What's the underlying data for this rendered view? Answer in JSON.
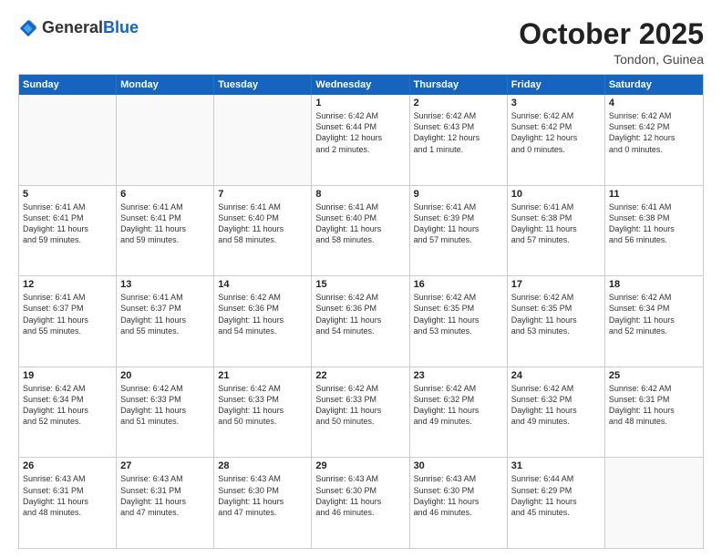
{
  "header": {
    "logo_general": "General",
    "logo_blue": "Blue",
    "month_title": "October 2025",
    "location": "Tondon, Guinea"
  },
  "days_of_week": [
    "Sunday",
    "Monday",
    "Tuesday",
    "Wednesday",
    "Thursday",
    "Friday",
    "Saturday"
  ],
  "weeks": [
    [
      {
        "day": "",
        "empty": true
      },
      {
        "day": "",
        "empty": true
      },
      {
        "day": "",
        "empty": true
      },
      {
        "day": "1",
        "lines": [
          "Sunrise: 6:42 AM",
          "Sunset: 6:44 PM",
          "Daylight: 12 hours",
          "and 2 minutes."
        ]
      },
      {
        "day": "2",
        "lines": [
          "Sunrise: 6:42 AM",
          "Sunset: 6:43 PM",
          "Daylight: 12 hours",
          "and 1 minute."
        ]
      },
      {
        "day": "3",
        "lines": [
          "Sunrise: 6:42 AM",
          "Sunset: 6:42 PM",
          "Daylight: 12 hours",
          "and 0 minutes."
        ]
      },
      {
        "day": "4",
        "lines": [
          "Sunrise: 6:42 AM",
          "Sunset: 6:42 PM",
          "Daylight: 12 hours",
          "and 0 minutes."
        ]
      }
    ],
    [
      {
        "day": "5",
        "lines": [
          "Sunrise: 6:41 AM",
          "Sunset: 6:41 PM",
          "Daylight: 11 hours",
          "and 59 minutes."
        ]
      },
      {
        "day": "6",
        "lines": [
          "Sunrise: 6:41 AM",
          "Sunset: 6:41 PM",
          "Daylight: 11 hours",
          "and 59 minutes."
        ]
      },
      {
        "day": "7",
        "lines": [
          "Sunrise: 6:41 AM",
          "Sunset: 6:40 PM",
          "Daylight: 11 hours",
          "and 58 minutes."
        ]
      },
      {
        "day": "8",
        "lines": [
          "Sunrise: 6:41 AM",
          "Sunset: 6:40 PM",
          "Daylight: 11 hours",
          "and 58 minutes."
        ]
      },
      {
        "day": "9",
        "lines": [
          "Sunrise: 6:41 AM",
          "Sunset: 6:39 PM",
          "Daylight: 11 hours",
          "and 57 minutes."
        ]
      },
      {
        "day": "10",
        "lines": [
          "Sunrise: 6:41 AM",
          "Sunset: 6:38 PM",
          "Daylight: 11 hours",
          "and 57 minutes."
        ]
      },
      {
        "day": "11",
        "lines": [
          "Sunrise: 6:41 AM",
          "Sunset: 6:38 PM",
          "Daylight: 11 hours",
          "and 56 minutes."
        ]
      }
    ],
    [
      {
        "day": "12",
        "lines": [
          "Sunrise: 6:41 AM",
          "Sunset: 6:37 PM",
          "Daylight: 11 hours",
          "and 55 minutes."
        ]
      },
      {
        "day": "13",
        "lines": [
          "Sunrise: 6:41 AM",
          "Sunset: 6:37 PM",
          "Daylight: 11 hours",
          "and 55 minutes."
        ]
      },
      {
        "day": "14",
        "lines": [
          "Sunrise: 6:42 AM",
          "Sunset: 6:36 PM",
          "Daylight: 11 hours",
          "and 54 minutes."
        ]
      },
      {
        "day": "15",
        "lines": [
          "Sunrise: 6:42 AM",
          "Sunset: 6:36 PM",
          "Daylight: 11 hours",
          "and 54 minutes."
        ]
      },
      {
        "day": "16",
        "lines": [
          "Sunrise: 6:42 AM",
          "Sunset: 6:35 PM",
          "Daylight: 11 hours",
          "and 53 minutes."
        ]
      },
      {
        "day": "17",
        "lines": [
          "Sunrise: 6:42 AM",
          "Sunset: 6:35 PM",
          "Daylight: 11 hours",
          "and 53 minutes."
        ]
      },
      {
        "day": "18",
        "lines": [
          "Sunrise: 6:42 AM",
          "Sunset: 6:34 PM",
          "Daylight: 11 hours",
          "and 52 minutes."
        ]
      }
    ],
    [
      {
        "day": "19",
        "lines": [
          "Sunrise: 6:42 AM",
          "Sunset: 6:34 PM",
          "Daylight: 11 hours",
          "and 52 minutes."
        ]
      },
      {
        "day": "20",
        "lines": [
          "Sunrise: 6:42 AM",
          "Sunset: 6:33 PM",
          "Daylight: 11 hours",
          "and 51 minutes."
        ]
      },
      {
        "day": "21",
        "lines": [
          "Sunrise: 6:42 AM",
          "Sunset: 6:33 PM",
          "Daylight: 11 hours",
          "and 50 minutes."
        ]
      },
      {
        "day": "22",
        "lines": [
          "Sunrise: 6:42 AM",
          "Sunset: 6:33 PM",
          "Daylight: 11 hours",
          "and 50 minutes."
        ]
      },
      {
        "day": "23",
        "lines": [
          "Sunrise: 6:42 AM",
          "Sunset: 6:32 PM",
          "Daylight: 11 hours",
          "and 49 minutes."
        ]
      },
      {
        "day": "24",
        "lines": [
          "Sunrise: 6:42 AM",
          "Sunset: 6:32 PM",
          "Daylight: 11 hours",
          "and 49 minutes."
        ]
      },
      {
        "day": "25",
        "lines": [
          "Sunrise: 6:42 AM",
          "Sunset: 6:31 PM",
          "Daylight: 11 hours",
          "and 48 minutes."
        ]
      }
    ],
    [
      {
        "day": "26",
        "lines": [
          "Sunrise: 6:43 AM",
          "Sunset: 6:31 PM",
          "Daylight: 11 hours",
          "and 48 minutes."
        ]
      },
      {
        "day": "27",
        "lines": [
          "Sunrise: 6:43 AM",
          "Sunset: 6:31 PM",
          "Daylight: 11 hours",
          "and 47 minutes."
        ]
      },
      {
        "day": "28",
        "lines": [
          "Sunrise: 6:43 AM",
          "Sunset: 6:30 PM",
          "Daylight: 11 hours",
          "and 47 minutes."
        ]
      },
      {
        "day": "29",
        "lines": [
          "Sunrise: 6:43 AM",
          "Sunset: 6:30 PM",
          "Daylight: 11 hours",
          "and 46 minutes."
        ]
      },
      {
        "day": "30",
        "lines": [
          "Sunrise: 6:43 AM",
          "Sunset: 6:30 PM",
          "Daylight: 11 hours",
          "and 46 minutes."
        ]
      },
      {
        "day": "31",
        "lines": [
          "Sunrise: 6:44 AM",
          "Sunset: 6:29 PM",
          "Daylight: 11 hours",
          "and 45 minutes."
        ]
      },
      {
        "day": "",
        "empty": true
      }
    ]
  ]
}
